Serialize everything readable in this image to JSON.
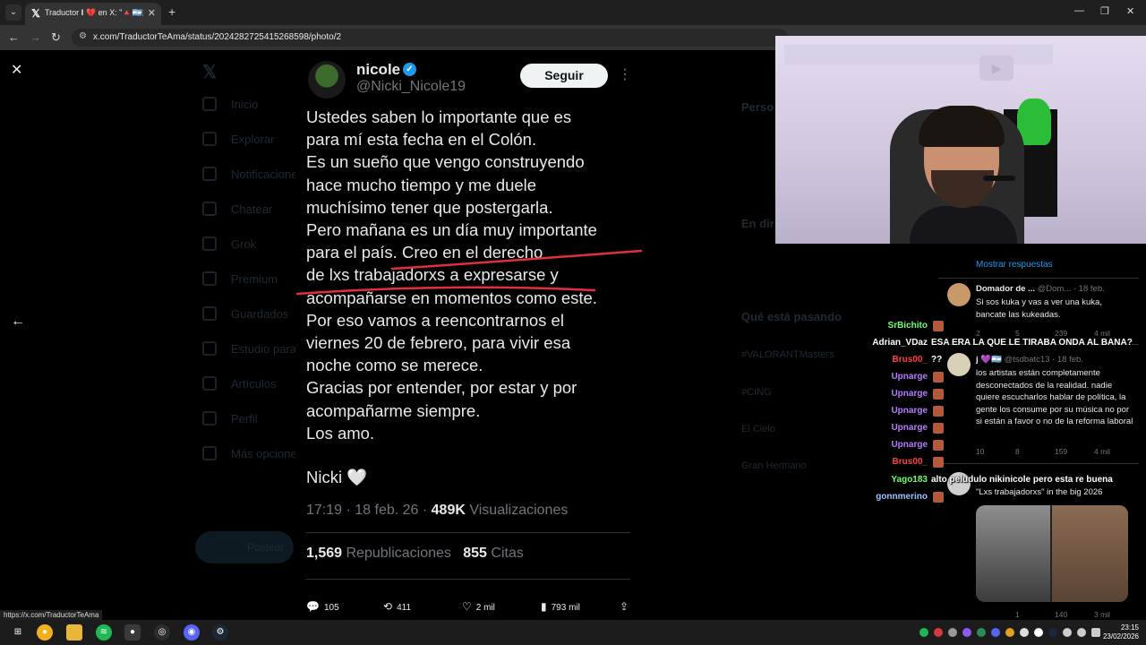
{
  "browser": {
    "tab_title": "Traductor 𝐈 💔 en X: \"🔺🇦🇷🇺",
    "url": "x.com/TraductorTeAma/status/2024282725415268598/photo/2",
    "status_url": "https://x.com/TraductorTeAma"
  },
  "background_app": {
    "sidebar": [
      "Inicio",
      "Explorar",
      "Notificaciones",
      "Chatear",
      "Grok",
      "Premium",
      "Guardados",
      "Estudio para",
      "Artículos",
      "Perfil",
      "Más opciones"
    ],
    "post_button": "Postear",
    "right_items": [
      "Perso",
      "En dir",
      "Qué está pasando",
      "#VALORANTMasters",
      "#CING",
      "El Cielo",
      "Gran Hermano"
    ]
  },
  "tweet": {
    "name": "nicole",
    "handle": "@Nicki_Nicole19",
    "follow": "Seguir",
    "lines": [
      "Ustedes saben lo importante que es",
      "para mí esta fecha en el Colón.",
      "Es un sueño que vengo construyendo",
      "hace mucho tiempo y me duele",
      "muchísimo tener que postergarla.",
      "Pero mañana es un día muy importante",
      "para el país. Creo en el derecho",
      "de lxs trabajadorxs a expresarse y",
      "acompañarse en momentos como este.",
      "Por eso vamos a reencontrarnos el",
      "viernes 20 de febrero, para vivir esa",
      "noche como se merece.",
      "Gracias por entender, por estar y por",
      "acompañarme siempre.",
      "Los amo."
    ],
    "signature": "Nicki 🤍",
    "time": "17:19 · 18 feb. 26 · ",
    "views_count": "489K",
    "views_label": " Visualizaciones",
    "reposts_count": "1,569",
    "reposts_label": " Republicaciones",
    "quotes_count": "855",
    "quotes_label": " Citas"
  },
  "actions": {
    "replies": "105",
    "reposts": "411",
    "likes": "2 mil",
    "views": "793 mil"
  },
  "replies_panel": {
    "show_more": "Mostrar respuestas",
    "items": [
      {
        "name": "Domador de ...",
        "meta": " @Dom... · 18 feb.",
        "text": "Si sos kuka y vas a ver una kuka, bancate las kukeadas.",
        "stats": [
          "2",
          "5",
          "239",
          "4 mil"
        ]
      },
      {
        "name": "j 💜🇦🇷",
        "meta": " @tsdbatc13 · 18 feb.",
        "text": "los artistas están completamente desconectados de la realidad. nadie quiere escucharlos hablar de política, la gente los consume por su música no por si están a favor o no de la reforma laboral",
        "stats": [
          "10",
          "8",
          "159",
          "4 mil"
        ]
      },
      {
        "name": "",
        "meta": "",
        "text": "\"Lxs trabajadorxs\" in the big 2026",
        "stats": [
          "",
          "1",
          "140",
          "3 mil"
        ]
      }
    ]
  },
  "chat": [
    {
      "user": "SrBichito",
      "msg": "",
      "color": "#6dff6d"
    },
    {
      "user": "Adrian_VDaz",
      "msg": "ESA ERA LA QUE LE TIRABA ONDA AL BANA?",
      "color": "#ffffff"
    },
    {
      "user": "Brus00_",
      "msg": "??",
      "color": "#ff4040"
    },
    {
      "user": "Upnarge",
      "msg": "",
      "color": "#b57bff"
    },
    {
      "user": "Upnarge",
      "msg": "",
      "color": "#b57bff"
    },
    {
      "user": "Upnarge",
      "msg": "",
      "color": "#b57bff"
    },
    {
      "user": "Upnarge",
      "msg": "",
      "color": "#b57bff"
    },
    {
      "user": "Upnarge",
      "msg": "",
      "color": "#b57bff"
    },
    {
      "user": "Brus00_",
      "msg": "",
      "color": "#ff4040"
    },
    {
      "user": "Yago183",
      "msg": "alto peludulo nikinicole pero esta re buena",
      "color": "#6dff6d"
    },
    {
      "user": "gonnmerino",
      "msg": "",
      "color": "#9bc3ff"
    }
  ],
  "clock": {
    "time": "23:15",
    "date": "23/02/2026"
  },
  "colors": {
    "accent": "#1d9bf0",
    "underline": "#e0313b"
  }
}
